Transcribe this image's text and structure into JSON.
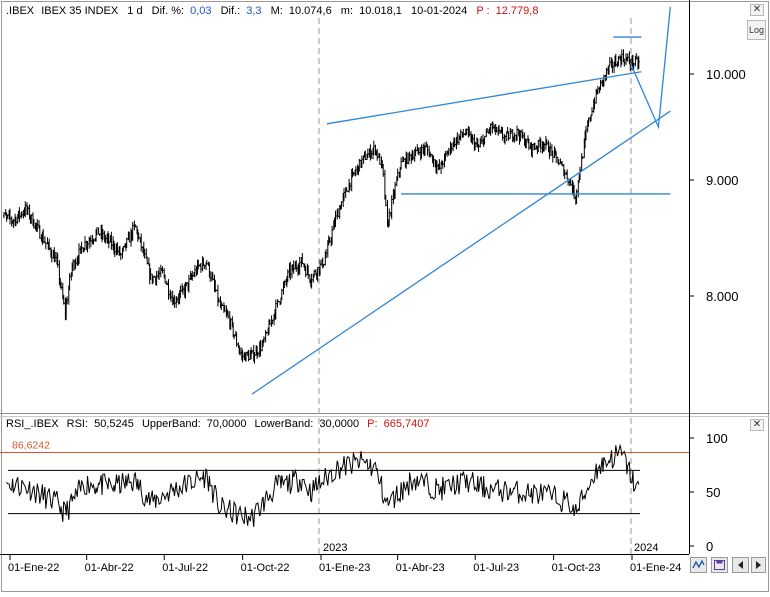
{
  "header": {
    "symbol": ".IBEX",
    "name": "IBEX 35 INDEX",
    "period": "1 d",
    "dif_pct_label": "Dif. %:",
    "dif_pct_value": "0,03",
    "dif_label": "Dif.:",
    "dif_value": "3,3",
    "max_label": "M:",
    "max_value": "10.074,6",
    "min_label": "m:",
    "min_value": "10.018,1",
    "date": "10-01-2024",
    "price_label": "P :",
    "price_value": "12.779,8"
  },
  "log_button": "Log",
  "corner_buttons": {
    "close_glyph": "✕",
    "restore_glyph": "□"
  },
  "rsi_header": {
    "symbol": "RSI_.IBEX",
    "rsi_label": "RSI:",
    "rsi_value": "50,5245",
    "upper_label": "UpperBand:",
    "upper_value": "70,0000",
    "lower_label": "LowerBand:",
    "lower_value": "30,0000",
    "p_label": "P:",
    "p_value": "665,7407"
  },
  "rsi_max_label": "86,6242",
  "icons": [
    "zigzag-icon",
    "save-icon",
    "left-arrow-icon",
    "right-arrow-icon"
  ],
  "colors": {
    "up_value": "#1f55c8",
    "price_red": "#d01010",
    "trendline": "#2f86d6",
    "rsi_max_line": "#d9552b",
    "price_bars": "#000000",
    "rsi_line": "#000000"
  },
  "chart_data": [
    {
      "type": "ohlc",
      "title": ".IBEX IBEX 35 INDEX 1 d",
      "x_axis_ticks": [
        "01-Ene-22",
        "01-Abr-22",
        "01-Jul-22",
        "01-Oct-22",
        "01-Ene-23",
        "01-Abr-23",
        "01-Jul-23",
        "01-Oct-23",
        "01-Ene-24"
      ],
      "year_markers": [
        "2023",
        "2024"
      ],
      "y_axis_ticks": [
        "8.000",
        "9.000",
        "10.000"
      ],
      "y_axis_label_values": [
        8000,
        9000,
        10000
      ],
      "ylim": [
        7000,
        10500
      ],
      "x_range": [
        "2021-12-20",
        "2024-02-15"
      ],
      "grid": false,
      "price_series": {
        "dates": [
          "2021-12-20",
          "2022-01-05",
          "2022-01-20",
          "2022-02-05",
          "2022-02-25",
          "2022-03-07",
          "2022-03-15",
          "2022-03-30",
          "2022-04-15",
          "2022-05-01",
          "2022-05-12",
          "2022-05-28",
          "2022-06-08",
          "2022-06-16",
          "2022-06-30",
          "2022-07-12",
          "2022-07-25",
          "2022-08-10",
          "2022-08-20",
          "2022-09-05",
          "2022-09-15",
          "2022-09-30",
          "2022-10-12",
          "2022-10-25",
          "2022-11-10",
          "2022-11-25",
          "2022-12-10",
          "2022-12-20",
          "2023-01-05",
          "2023-01-20",
          "2023-02-05",
          "2023-02-20",
          "2023-03-06",
          "2023-03-15",
          "2023-03-20",
          "2023-04-05",
          "2023-04-20",
          "2023-05-05",
          "2023-05-20",
          "2023-06-05",
          "2023-06-20",
          "2023-07-05",
          "2023-07-20",
          "2023-08-05",
          "2023-08-20",
          "2023-09-05",
          "2023-09-20",
          "2023-10-05",
          "2023-10-20",
          "2023-10-27",
          "2023-11-10",
          "2023-11-20",
          "2023-12-05",
          "2023-12-20",
          "2024-01-02",
          "2024-01-10"
        ],
        "close": [
          8700,
          8650,
          8750,
          8550,
          8300,
          7850,
          8250,
          8450,
          8550,
          8450,
          8350,
          8600,
          8350,
          8150,
          8200,
          7950,
          8050,
          8250,
          8300,
          7900,
          7800,
          7450,
          7450,
          7550,
          7900,
          8200,
          8300,
          8150,
          8300,
          8700,
          9000,
          9200,
          9300,
          9100,
          8600,
          9150,
          9250,
          9300,
          9100,
          9350,
          9450,
          9300,
          9500,
          9400,
          9450,
          9300,
          9350,
          9200,
          9000,
          8850,
          9500,
          9800,
          10050,
          10150,
          10100,
          10100
        ]
      },
      "trendlines": [
        {
          "name": "support",
          "from": [
            "2022-10-12",
            7100
          ],
          "to": [
            "2024-02-15",
            9650
          ]
        },
        {
          "name": "resistance",
          "from": [
            "2023-01-08",
            9530
          ],
          "to": [
            "2024-01-12",
            10020
          ]
        },
        {
          "name": "horizontal support",
          "from": [
            "2023-04-05",
            8880
          ],
          "to": [
            "2024-02-15",
            8880
          ]
        },
        {
          "name": "consolidation top",
          "from": [
            "2023-12-10",
            10330
          ],
          "to": [
            "2024-01-12",
            10330
          ]
        },
        {
          "name": "projection",
          "from": [
            "2023-12-30",
            10100
          ],
          "via": [
            "2024-02-01",
            9500
          ],
          "to": [
            "2024-02-15",
            10600
          ]
        }
      ]
    },
    {
      "type": "line",
      "title": "RSI_.IBEX",
      "y_axis_ticks": [
        "0",
        "50",
        "100"
      ],
      "ylim": [
        0,
        100
      ],
      "bands": {
        "upper": 70,
        "lower": 30,
        "max": 86.6242
      },
      "rsi_series": {
        "dates": [
          "2021-12-20",
          "2022-01-20",
          "2022-02-25",
          "2022-03-07",
          "2022-03-30",
          "2022-04-30",
          "2022-05-28",
          "2022-06-16",
          "2022-07-12",
          "2022-08-20",
          "2022-09-05",
          "2022-09-30",
          "2022-10-12",
          "2022-11-10",
          "2022-12-10",
          "2022-12-20",
          "2023-01-20",
          "2023-02-20",
          "2023-03-06",
          "2023-03-20",
          "2023-04-20",
          "2023-05-20",
          "2023-06-20",
          "2023-07-20",
          "2023-08-20",
          "2023-09-20",
          "2023-10-20",
          "2023-10-27",
          "2023-11-20",
          "2023-12-05",
          "2023-12-20",
          "2024-01-02",
          "2024-01-10"
        ],
        "values": [
          60,
          55,
          40,
          30,
          58,
          55,
          60,
          40,
          52,
          65,
          35,
          28,
          26,
          55,
          62,
          50,
          72,
          78,
          72,
          38,
          62,
          52,
          60,
          52,
          50,
          48,
          40,
          30,
          70,
          80,
          86,
          62,
          50
        ]
      }
    }
  ]
}
